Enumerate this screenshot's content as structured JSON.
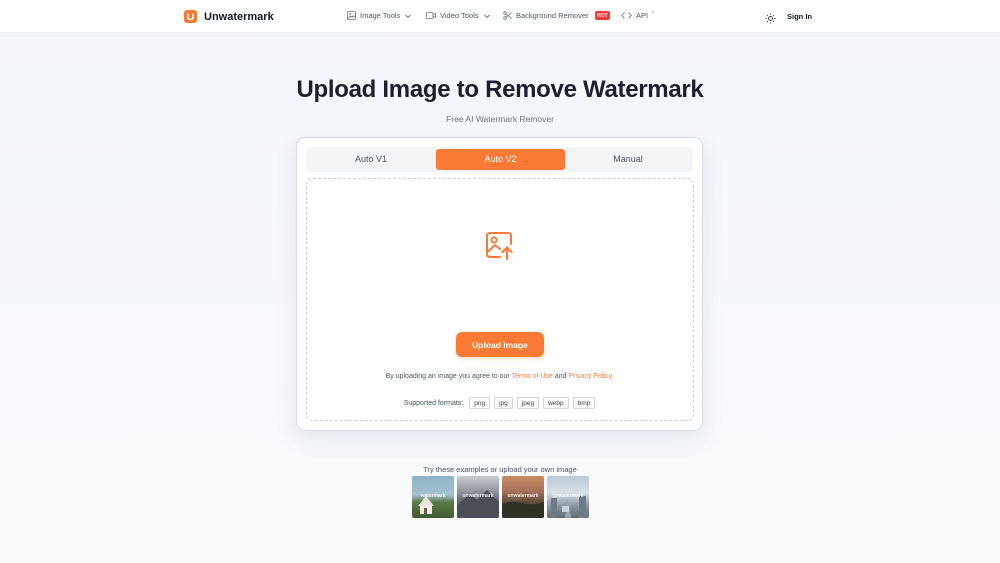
{
  "header": {
    "brand": "Unwatermark",
    "brand_letter": "U",
    "nav": [
      {
        "label": "Image Tools",
        "icon": "image-icon",
        "dropdown": true
      },
      {
        "label": "Video Tools",
        "icon": "video-icon",
        "dropdown": true
      },
      {
        "label": "Background Remover",
        "icon": "scissors-icon",
        "badge": "HOT"
      },
      {
        "label": "API",
        "icon": "code-icon",
        "superscript": "N"
      }
    ],
    "theme_icon": "sun-icon",
    "sign_in": "Sign In"
  },
  "hero": {
    "title": "Upload Image to Remove Watermark",
    "subtitle": "Free AI Watermark Remover"
  },
  "uploader": {
    "tabs": [
      {
        "label": "Auto V1",
        "active": false
      },
      {
        "label": "Auto V2",
        "active": true
      },
      {
        "label": "Manual",
        "active": false
      }
    ],
    "upload_icon": "image-upload-icon",
    "upload_button": "Upload image",
    "agree_prefix": "By uploading an image you agree to our",
    "terms_link": "Terms of Use",
    "agree_and": "and",
    "privacy_link": "Privacy Policy",
    "agree_suffix": ".",
    "formats_label": "Supported formats:",
    "formats": [
      "png",
      "jpg",
      "jpeg",
      "webp",
      "bmp"
    ]
  },
  "examples": {
    "label": "Try these examples or upload your own image",
    "items": [
      {
        "watermark": "watermark"
      },
      {
        "watermark": "unwatermark"
      },
      {
        "watermark": "unwatermark"
      },
      {
        "watermark": "unwatermark"
      }
    ]
  },
  "colors": {
    "accent": "#f97a35",
    "hot_badge": "#ef3b3b",
    "title": "#1a2030"
  }
}
